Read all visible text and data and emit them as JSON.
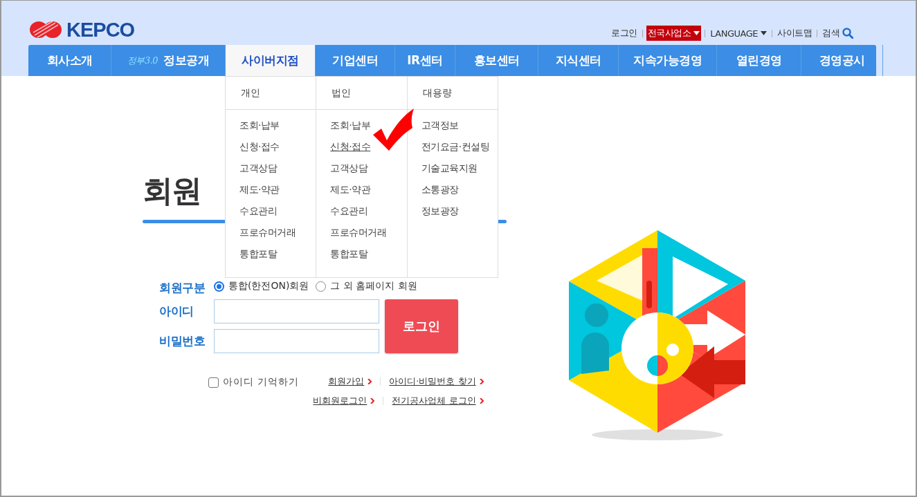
{
  "logo": {
    "text": "KEPCO"
  },
  "utility_links": [
    {
      "label": "로그인",
      "kind": "link",
      "highlighted": false
    },
    {
      "label": "전국사업소",
      "kind": "dropdown",
      "highlighted": true
    },
    {
      "label": "LANGUAGE",
      "kind": "dropdown",
      "highlighted": false
    },
    {
      "label": "사이트맵",
      "kind": "link",
      "highlighted": false
    },
    {
      "label": "검색",
      "kind": "search",
      "highlighted": false
    }
  ],
  "nav": [
    {
      "label": "회사소개",
      "selected": false
    },
    {
      "label": "정보공개",
      "badge": "정부3.0",
      "selected": false
    },
    {
      "label": "사이버지점",
      "selected": true
    },
    {
      "label": "기업센터",
      "selected": false
    },
    {
      "label": "IR센터",
      "selected": false
    },
    {
      "label": "홍보센터",
      "selected": false
    },
    {
      "label": "지식센터",
      "selected": false
    },
    {
      "label": "지속가능경영",
      "selected": false
    },
    {
      "label": "열린경영",
      "selected": false
    },
    {
      "label": "경영공시",
      "selected": false
    }
  ],
  "dropdown": {
    "columns": [
      {
        "title": "개인",
        "items": [
          {
            "label": "조회·납부",
            "hovered": false
          },
          {
            "label": "신청·접수",
            "hovered": false
          },
          {
            "label": "고객상담",
            "hovered": false
          },
          {
            "label": "제도·약관",
            "hovered": false
          },
          {
            "label": "수요관리",
            "hovered": false
          },
          {
            "label": "프로슈머거래",
            "hovered": false
          },
          {
            "label": "통합포탈",
            "hovered": false
          }
        ]
      },
      {
        "title": "법인",
        "items": [
          {
            "label": "조회·납부",
            "hovered": false
          },
          {
            "label": "신청·접수",
            "hovered": true
          },
          {
            "label": "고객상담",
            "hovered": false
          },
          {
            "label": "제도·약관",
            "hovered": false
          },
          {
            "label": "수요관리",
            "hovered": false
          },
          {
            "label": "프로슈머거래",
            "hovered": false
          },
          {
            "label": "통합포탈",
            "hovered": false
          }
        ]
      },
      {
        "title": "대용량",
        "items": [
          {
            "label": "고객정보",
            "hovered": false
          },
          {
            "label": "전기요금·컨설팅",
            "hovered": false
          },
          {
            "label": "기술교육지원",
            "hovered": false
          },
          {
            "label": "소통광장",
            "hovered": false
          },
          {
            "label": "정보광장",
            "hovered": false
          }
        ]
      }
    ]
  },
  "page_title": "회원",
  "form": {
    "member_type_label": "회원구분",
    "member_types": [
      {
        "label": "통합(한전ON)회원",
        "selected": true
      },
      {
        "label": "그 외 홈페이지 회원",
        "selected": false
      }
    ],
    "id_label": "아이디",
    "password_label": "비밀번호",
    "login_button": "로그인",
    "remember_id": {
      "label": "아이디 기억하기",
      "checked": false
    },
    "links": [
      [
        "회원가입",
        "아이디·비밀번호 찾기"
      ],
      [
        "비회원로그인",
        "전기공사업체 로그인"
      ]
    ]
  }
}
